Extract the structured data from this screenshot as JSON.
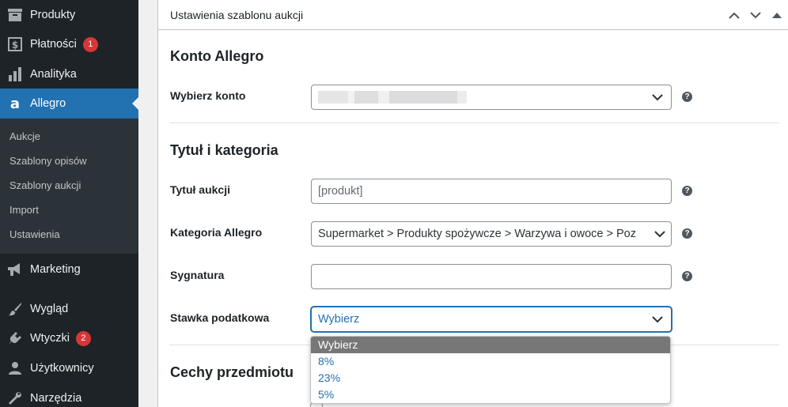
{
  "sidebar": {
    "items": [
      {
        "label": "Produkty",
        "icon": "archive-icon"
      },
      {
        "label": "Płatności",
        "icon": "dollar-icon",
        "badge": "1"
      },
      {
        "label": "Analityka",
        "icon": "bar-chart-icon"
      },
      {
        "label": "Allegro",
        "icon": "allegro-icon",
        "active": true
      },
      {
        "label": "Marketing",
        "icon": "megaphone-icon"
      },
      {
        "label": "Wygląd",
        "icon": "paintbrush-icon"
      },
      {
        "label": "Wtyczki",
        "icon": "plugin-icon",
        "badge": "2"
      },
      {
        "label": "Użytkownicy",
        "icon": "user-icon"
      },
      {
        "label": "Narzędzia",
        "icon": "wrench-icon"
      }
    ],
    "submenu": [
      "Aukcje",
      "Szablony opisów",
      "Szablony aukcji",
      "Import",
      "Ustawienia"
    ]
  },
  "panel": {
    "title": "Ustawienia szablonu aukcji"
  },
  "sections": {
    "account": {
      "title": "Konto Allegro",
      "label": "Wybierz konto"
    },
    "title_category": {
      "title": "Tytuł i kategoria",
      "auction_title_label": "Tytuł aukcji",
      "auction_title_placeholder": "[produkt]",
      "category_label": "Kategoria Allegro",
      "category_value": "Supermarket > Produkty spożywcze > Warzywa i owoce > Poz",
      "signature_label": "Sygnatura",
      "signature_value": "",
      "tax_label": "Stawka podatkowa",
      "tax_value": "Wybierz"
    },
    "features": {
      "title": "Cechy przedmiotu"
    }
  },
  "tax_options": [
    "Wybierz",
    "8%",
    "23%",
    "5%"
  ],
  "help_glyph": "?",
  "colors": {
    "sidebar_bg": "#1d2327",
    "accent": "#2271b1",
    "badge": "#d63638"
  }
}
